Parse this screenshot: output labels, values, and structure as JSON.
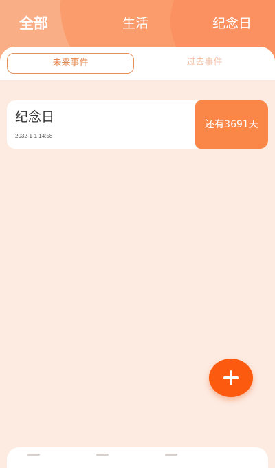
{
  "nav": {
    "items": [
      {
        "label": "全部",
        "active": true
      },
      {
        "label": "生活",
        "active": false
      },
      {
        "label": "纪念日",
        "active": false
      }
    ]
  },
  "tabs": {
    "future": "未来事件",
    "past": "过去事件",
    "selected": "未来事件"
  },
  "events": [
    {
      "title": "纪念日",
      "datetime": "2032-1-1 14:58",
      "countdown": "还有3691天"
    }
  ],
  "colors": {
    "header": "#F9AE86",
    "accent": "#FA8648",
    "fab": "#FC5A0E",
    "background": "#FDEAE0"
  },
  "fab": {
    "icon": "plus-icon"
  }
}
